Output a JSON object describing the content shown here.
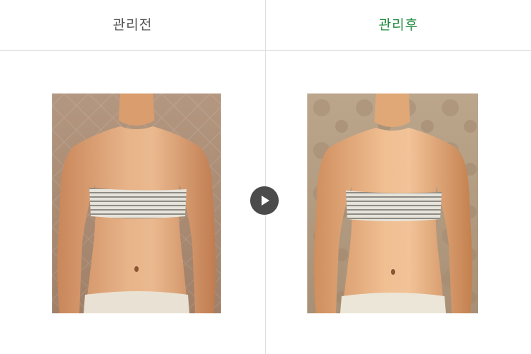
{
  "before": {
    "label": "관리전",
    "label_color": "#555555"
  },
  "after": {
    "label": "관리후",
    "label_color": "#1f8a3c"
  },
  "play_button": {
    "icon": "play-icon",
    "color": "#4b4b4b"
  },
  "colors": {
    "divider": "#dedede",
    "background": "#ffffff"
  }
}
